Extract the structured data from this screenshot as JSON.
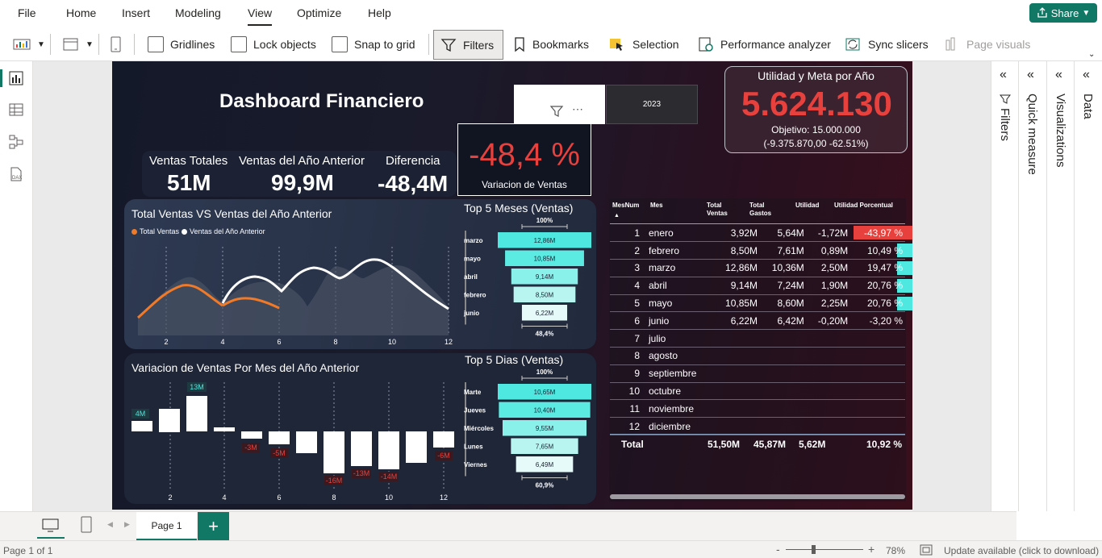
{
  "menubar": {
    "items": [
      {
        "label": "File"
      },
      {
        "label": "Home"
      },
      {
        "label": "Insert"
      },
      {
        "label": "Modeling"
      },
      {
        "label": "View",
        "active": true
      },
      {
        "label": "Optimize"
      },
      {
        "label": "Help"
      }
    ],
    "share_label": "Share"
  },
  "ribbon": {
    "gridlines": "Gridlines",
    "lock_objects": "Lock objects",
    "snap_to_grid": "Snap to grid",
    "filters": "Filters",
    "bookmarks": "Bookmarks",
    "selection": "Selection",
    "performance": "Performance analyzer",
    "sync_slicers": "Sync slicers",
    "page_visuals": "Page visuals"
  },
  "report": {
    "title": "Dashboard Financiero",
    "slicer_value": "2023",
    "kpi_util": {
      "title": "Utilidad y Meta por Año",
      "value": "5.624.130",
      "alert": "!",
      "goal": "Objetivo: 15.000.000",
      "delta": "(-9.375.870,00 -62.51%)"
    },
    "cards": [
      {
        "label": "Ventas Totales",
        "value": "51M"
      },
      {
        "label": "Ventas del Año Anterior",
        "value": "99,9M"
      },
      {
        "label": "Diferencia",
        "value": "-48,4M"
      }
    ],
    "variation": {
      "value": "-48,4 %",
      "label": "Variacion de Ventas"
    },
    "line_chart": {
      "title": "Total Ventas VS Ventas del Año Anterior",
      "legend": [
        "Total Ventas",
        "Ventas del Año Anterior"
      ],
      "xticks": [
        "2",
        "4",
        "6",
        "8",
        "10",
        "12"
      ]
    },
    "top_months": {
      "title": "Top 5 Meses (Ventas)",
      "top_pct": "100%",
      "bottom_pct": "48,4%",
      "items": [
        {
          "label": "marzo",
          "value": "12,86M",
          "v": 12.86
        },
        {
          "label": "mayo",
          "value": "10,85M",
          "v": 10.85
        },
        {
          "label": "abril",
          "value": "9,14M",
          "v": 9.14
        },
        {
          "label": "febrero",
          "value": "8,50M",
          "v": 8.5
        },
        {
          "label": "junio",
          "value": "6,22M",
          "v": 6.22
        }
      ]
    },
    "waterfall": {
      "title": "Variacion de Ventas Por Mes del Año Anterior",
      "xticks": [
        "2",
        "4",
        "6",
        "8",
        "10",
        "12"
      ],
      "labels": {
        "a": "4M",
        "b": "13M",
        "c": "-3M",
        "d": "-5M",
        "e": "-16M",
        "f": "-13M",
        "g": "-14M",
        "h": "-6M"
      }
    },
    "top_days": {
      "title": "Top 5 Dias (Ventas)",
      "top_pct": "100%",
      "bottom_pct": "60,9%",
      "items": [
        {
          "label": "Marte",
          "value": "10,65M",
          "v": 10.65
        },
        {
          "label": "Jueves",
          "value": "10,40M",
          "v": 10.4
        },
        {
          "label": "Miércoles",
          "value": "9,55M",
          "v": 9.55
        },
        {
          "label": "Lunes",
          "value": "7,65M",
          "v": 7.65
        },
        {
          "label": "Viernes",
          "value": "6,49M",
          "v": 6.49
        }
      ]
    },
    "table": {
      "headers": [
        "MesNum",
        "Mes",
        "Total Ventas",
        "Total Gastos",
        "Utilidad",
        "Utilidad Porcentual"
      ],
      "rows": [
        {
          "n": "1",
          "mes": "enero",
          "v": "3,92M",
          "g": "5,64M",
          "u": "-1,72M",
          "p": "-43,97 %",
          "pv": -43.97
        },
        {
          "n": "2",
          "mes": "febrero",
          "v": "8,50M",
          "g": "7,61M",
          "u": "0,89M",
          "p": "10,49 %",
          "pv": 10.49
        },
        {
          "n": "3",
          "mes": "marzo",
          "v": "12,86M",
          "g": "10,36M",
          "u": "2,50M",
          "p": "19,47 %",
          "pv": 19.47
        },
        {
          "n": "4",
          "mes": "abril",
          "v": "9,14M",
          "g": "7,24M",
          "u": "1,90M",
          "p": "20,76 %",
          "pv": 20.76
        },
        {
          "n": "5",
          "mes": "mayo",
          "v": "10,85M",
          "g": "8,60M",
          "u": "2,25M",
          "p": "20,76 %",
          "pv": 20.76
        },
        {
          "n": "6",
          "mes": "junio",
          "v": "6,22M",
          "g": "6,42M",
          "u": "-0,20M",
          "p": "-3,20 %",
          "pv": -3.2
        },
        {
          "n": "7",
          "mes": "julio",
          "v": "",
          "g": "",
          "u": "",
          "p": "",
          "pv": 0
        },
        {
          "n": "8",
          "mes": "agosto",
          "v": "",
          "g": "",
          "u": "",
          "p": "",
          "pv": 0
        },
        {
          "n": "9",
          "mes": "septiembre",
          "v": "",
          "g": "",
          "u": "",
          "p": "",
          "pv": 0
        },
        {
          "n": "10",
          "mes": "octubre",
          "v": "",
          "g": "",
          "u": "",
          "p": "",
          "pv": 0
        },
        {
          "n": "11",
          "mes": "noviembre",
          "v": "",
          "g": "",
          "u": "",
          "p": "",
          "pv": 0
        },
        {
          "n": "12",
          "mes": "diciembre",
          "v": "",
          "g": "",
          "u": "",
          "p": "",
          "pv": 0
        }
      ],
      "total": {
        "label": "Total",
        "v": "51,50M",
        "g": "45,87M",
        "u": "5,62M",
        "p": "10,92 %"
      }
    }
  },
  "panes": {
    "filters": "Filters",
    "quick_measure": "Quick measure",
    "visualizations": "Visualizations",
    "data": "Data"
  },
  "pagebar": {
    "page_tab": "Page 1",
    "add": "+"
  },
  "status": {
    "page_info": "Page 1 of 1",
    "zoom": "78%",
    "update": "Update available (click to download)",
    "zoom_minus": "-",
    "zoom_plus": "+"
  },
  "colors": {
    "accent": "#117865",
    "cyan": "#4fe8e0",
    "red": "#e8403c",
    "orange": "#f07a28"
  }
}
